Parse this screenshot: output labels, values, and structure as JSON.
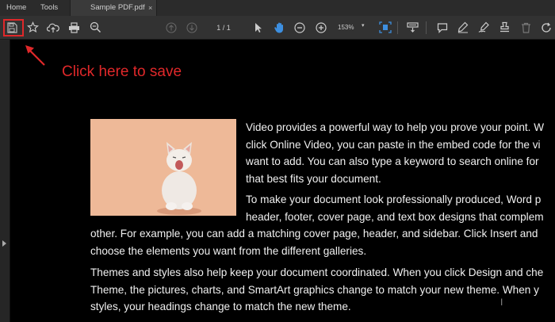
{
  "tabs": {
    "home": "Home",
    "tools": "Tools",
    "document": "Sample PDF.pdf",
    "close": "×"
  },
  "toolbar": {
    "page_current": "1",
    "page_total": "1",
    "page_display": "1  /  1",
    "zoom": "153%",
    "icons": [
      "save-icon",
      "star-icon",
      "cloud-upload-icon",
      "print-icon",
      "zoom-out-magnifier-icon",
      "page-up-icon",
      "page-down-icon",
      "select-cursor-icon",
      "hand-tool-icon",
      "zoom-minus-icon",
      "zoom-plus-icon",
      "fit-page-icon",
      "keyboard-scroll-icon",
      "comment-icon",
      "highlight-pen-icon",
      "sign-icon",
      "stamp-icon",
      "delete-icon",
      "rotate-icon"
    ]
  },
  "annotation": {
    "text": "Click here to save",
    "color": "#e0282a"
  },
  "document": {
    "paragraph1_lines": [
      "Video provides a powerful way to help you prove your point. W",
      "click Online Video, you can paste in the embed code for the vi",
      "want to add. You can also type a keyword to search online for",
      "that best fits your document."
    ],
    "paragraph2_lines_right": [
      "To make your document look professionally produced, Word p",
      "header, footer, cover page, and text box designs that complem"
    ],
    "paragraph2_lines_full": [
      "other. For example, you can add a matching cover page, header, and sidebar. Click Insert and",
      "choose the elements you want from the different galleries."
    ],
    "paragraph3_lines": [
      "Themes and styles also help keep your document coordinated. When you click Design and che",
      "Theme, the pictures, charts, and SmartArt graphics change to match your new theme. When y",
      "styles, your headings change to match the new theme."
    ]
  }
}
